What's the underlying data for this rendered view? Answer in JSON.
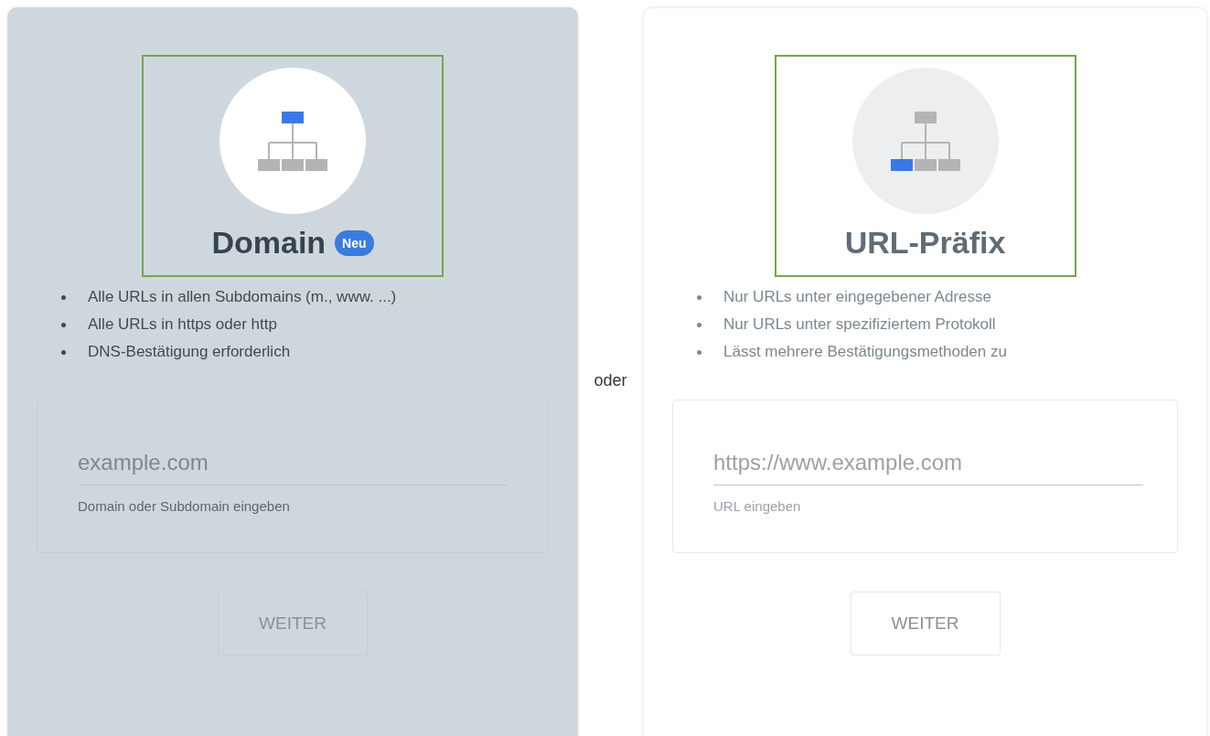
{
  "cards": [
    {
      "title": "Domain",
      "badge": "Neu",
      "selected": true,
      "icon_nodes": [
        {
          "highlighted": true
        },
        {
          "highlighted": false
        },
        {
          "highlighted": false
        },
        {
          "highlighted": false
        }
      ],
      "bullets": [
        "Alle URLs in allen Subdomains (m., www. ...)",
        "Alle URLs in https oder http",
        "DNS-Bestätigung erforderlich"
      ],
      "input": {
        "placeholder": "example.com",
        "hint": "Domain oder Subdomain eingeben"
      },
      "button": "WEITER"
    },
    {
      "title": "URL-Präfix",
      "selected": false,
      "icon_nodes": [
        {
          "highlighted": false
        },
        {
          "highlighted": true
        },
        {
          "highlighted": false
        },
        {
          "highlighted": false
        }
      ],
      "bullets": [
        "Nur URLs unter eingegebener Adresse",
        "Nur URLs unter spezifiziertem Protokoll",
        "Lässt mehrere Bestätigungsmethoden zu"
      ],
      "input": {
        "placeholder": "https://www.example.com",
        "hint": "URL eingeben"
      },
      "button": "WEITER"
    }
  ],
  "separator": "oder"
}
